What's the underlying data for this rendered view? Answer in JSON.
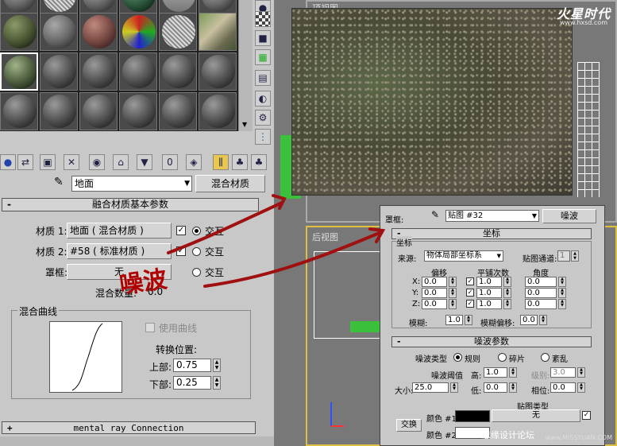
{
  "viewports": {
    "top_label": "顶视图",
    "back_label": "后视图"
  },
  "branding": {
    "logo": "火星时代",
    "logo_url": "www.hxsd.com",
    "watermark": "思缘设计论坛",
    "watermark_url": "www.MISSYUAN.COM"
  },
  "annotation": {
    "text": "噪波"
  },
  "material_editor": {
    "material_name": "地面",
    "material_type": "混合材质",
    "rollouts": {
      "blend_basic": "融合材质基本参数",
      "mental_ray": "mental ray Connection"
    },
    "blend": {
      "material1_label": "材质 1:",
      "material1_value": "地面  ( 混合材质 )",
      "material1_interactive": "交互",
      "material2_label": "材质 2:",
      "material2_value": "#58  ( 标准材质 )",
      "material2_interactive": "交互",
      "mask_label": "罩框:",
      "mask_value": "无",
      "mask_interactive": "交互",
      "mix_amount_label": "混合数量:",
      "mix_amount_value": "0.0",
      "mix_curve_title": "混合曲线",
      "use_curve_label": "使用曲线",
      "transition_label": "转换位置:",
      "upper_label": "上部:",
      "upper_value": "0.75",
      "lower_label": "下部:",
      "lower_value": "0.25"
    }
  },
  "noise_panel": {
    "mask_label": "罩框:",
    "map_name": "贴图 #32",
    "map_type": "噪波",
    "coords_header": "坐标",
    "coords_group": "坐标",
    "source_label": "来源:",
    "source_value": "物体局部坐标系",
    "map_channel_label": "贴图通道:",
    "map_channel_value": "1",
    "col_offset": "偏移",
    "col_tiling": "平铺次数",
    "col_angle": "角度",
    "rows": [
      {
        "axis": "X:",
        "offset": "0.0",
        "tiling": "1.0",
        "angle": "0.0"
      },
      {
        "axis": "Y:",
        "offset": "0.0",
        "tiling": "1.0",
        "angle": "0.0"
      },
      {
        "axis": "Z:",
        "offset": "0.0",
        "tiling": "1.0",
        "angle": "0.0"
      }
    ],
    "blur_label": "模糊:",
    "blur_value": "1.0",
    "blur_offset_label": "模糊偏移:",
    "blur_offset_value": "0.0",
    "noise_header": "噪波参数",
    "noise_type_label": "噪波类型",
    "type_regular": "规则",
    "type_fractal": "碎片",
    "type_turbulence": "紊乱",
    "threshold_label": "噪波阈值",
    "high_label": "高:",
    "high_value": "1.0",
    "levels_label": "级别:",
    "levels_value": "3.0",
    "size_label": "大小:",
    "size_value": "25.0",
    "low_label": "低:",
    "low_value": "0.0",
    "phase_label": "相位:",
    "phase_value": "0.0",
    "maps_label": "贴图类型",
    "swap_label": "交换",
    "color1_label": "颜色 #1",
    "color1_map": "无",
    "color2_label": "颜色 #2"
  },
  "colors": {
    "arrow": "#a01010",
    "annotation": "#b00000",
    "color1_swatch": "#000000",
    "color2_swatch": "#ffffff"
  }
}
